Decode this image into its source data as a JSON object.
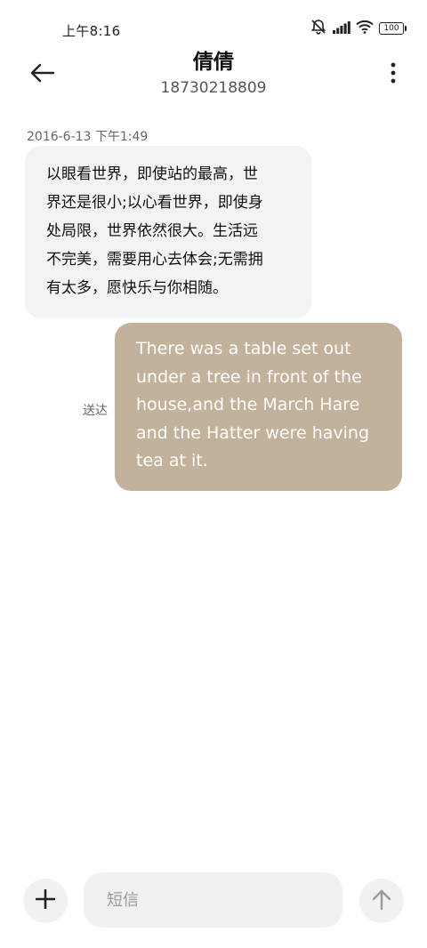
{
  "status_bar": {
    "time": "上午8:16",
    "icons": [
      "mute-icon",
      "signal-icon",
      "wifi-icon",
      "battery-icon"
    ],
    "battery_level": "100"
  },
  "header": {
    "contact_name": "倩倩",
    "phone_number": "18730218809",
    "back_icon": "arrow-left-icon",
    "more_icon": "more-vertical-icon"
  },
  "conversation": {
    "timestamp": "2016-6-13 下午1:49",
    "incoming_message": "以眼看世界，即使站的最高，世\n界还是很小;以心看世界，即使身\n处局限，世界依然很大。生活远\n不完美，需要用心去体会;无需拥\n有太多，愿快乐与你相随。",
    "outgoing_message": "There was a table set out\nunder a tree in front of the\nhouse,and the March Hare\nand the Hatter were having\ntea at it.",
    "delivery_status": "送达"
  },
  "composer": {
    "input_placeholder": "短信",
    "input_value": "",
    "add_icon": "plus-icon",
    "send_icon": "arrow-up-icon"
  },
  "colors": {
    "outgoing_bubble": "#c3b29b",
    "incoming_bubble": "#f3f3f3",
    "composer_background": "#f1f1f1"
  }
}
